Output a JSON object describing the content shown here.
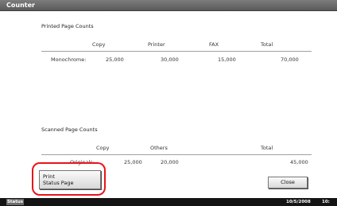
{
  "window": {
    "title": "Counter"
  },
  "printed": {
    "title": "Printed Page Counts",
    "columns": [
      "Copy",
      "Printer",
      "FAX",
      "Total"
    ],
    "rows": [
      {
        "label": "Monochrome:",
        "values": [
          "25,000",
          "30,000",
          "15,000",
          "70,000"
        ]
      }
    ]
  },
  "scanned": {
    "title": "Scanned Page Counts",
    "columns": [
      "Copy",
      "Others",
      "Total"
    ],
    "rows": [
      {
        "label": "Originals:",
        "values": [
          "25,000",
          "20,000",
          "45,000"
        ]
      }
    ]
  },
  "buttons": {
    "print_status_line1": "Print",
    "print_status_line2": "Status Page",
    "close": "Close"
  },
  "statusbar": {
    "status_label": "Status",
    "date": "10/5/2008",
    "time": "10:"
  },
  "highlight": {
    "color": "#e8141a"
  }
}
